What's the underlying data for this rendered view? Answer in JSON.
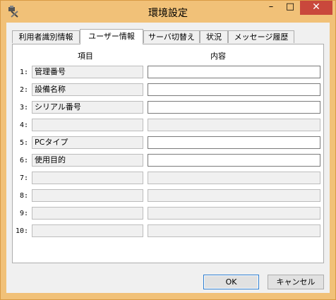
{
  "window": {
    "title": "環境設定",
    "minimize": "–",
    "maximize": "□",
    "close": "✕"
  },
  "tabs": [
    {
      "label": "利用者識別情報",
      "active": false
    },
    {
      "label": "ユーザー情報",
      "active": true
    },
    {
      "label": "サーバ切替え",
      "active": false
    },
    {
      "label": "状況",
      "active": false
    },
    {
      "label": "メッセージ履歴",
      "active": false
    }
  ],
  "table": {
    "col_item": "項目",
    "col_content": "内容",
    "rows": [
      {
        "num": "1:",
        "item": "管理番号",
        "content": "",
        "enabled": true
      },
      {
        "num": "2:",
        "item": "設備名称",
        "content": "",
        "enabled": true
      },
      {
        "num": "3:",
        "item": "シリアル番号",
        "content": "",
        "enabled": true
      },
      {
        "num": "4:",
        "item": "",
        "content": "",
        "enabled": false
      },
      {
        "num": "5:",
        "item": "PCタイプ",
        "content": "",
        "enabled": true
      },
      {
        "num": "6:",
        "item": "使用目的",
        "content": "",
        "enabled": true
      },
      {
        "num": "7:",
        "item": "",
        "content": "",
        "enabled": false
      },
      {
        "num": "8:",
        "item": "",
        "content": "",
        "enabled": false
      },
      {
        "num": "9:",
        "item": "",
        "content": "",
        "enabled": false
      },
      {
        "num": "10:",
        "item": "",
        "content": "",
        "enabled": false
      }
    ]
  },
  "buttons": {
    "ok": "OK",
    "cancel": "キャンセル"
  }
}
